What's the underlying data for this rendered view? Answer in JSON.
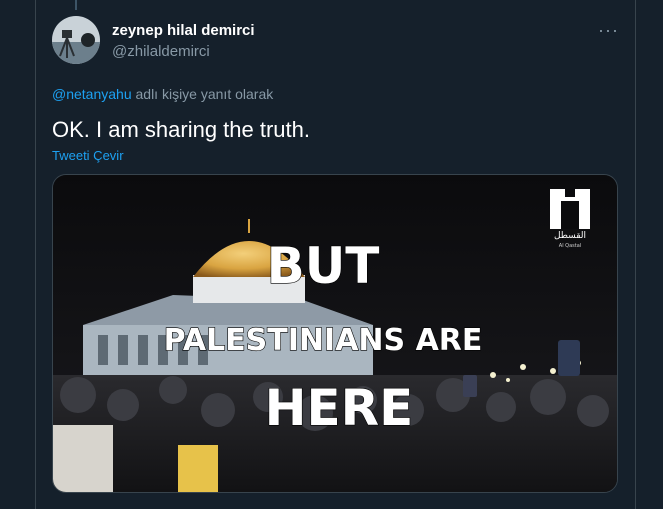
{
  "tweet": {
    "author_name": "zeynep hilal demirci",
    "author_handle": "@zhilaldemirci",
    "more_icon": "···",
    "reply_mention": "@netanyahu",
    "reply_suffix": " adlı kişiye yanıt olarak",
    "text": "OK. I am sharing the truth.",
    "translate_label": "Tweeti Çevir"
  },
  "media": {
    "caption_line1": "BUT",
    "caption_line2": "PALESTINIANS ARE",
    "caption_line3": "HERE",
    "logo_arabic": "القسطل",
    "logo_latin": "Al Qastal"
  },
  "colors": {
    "background": "#15202b",
    "accent": "#1da1f2",
    "muted": "#8899a6",
    "dome_gold": "#d9a441"
  }
}
